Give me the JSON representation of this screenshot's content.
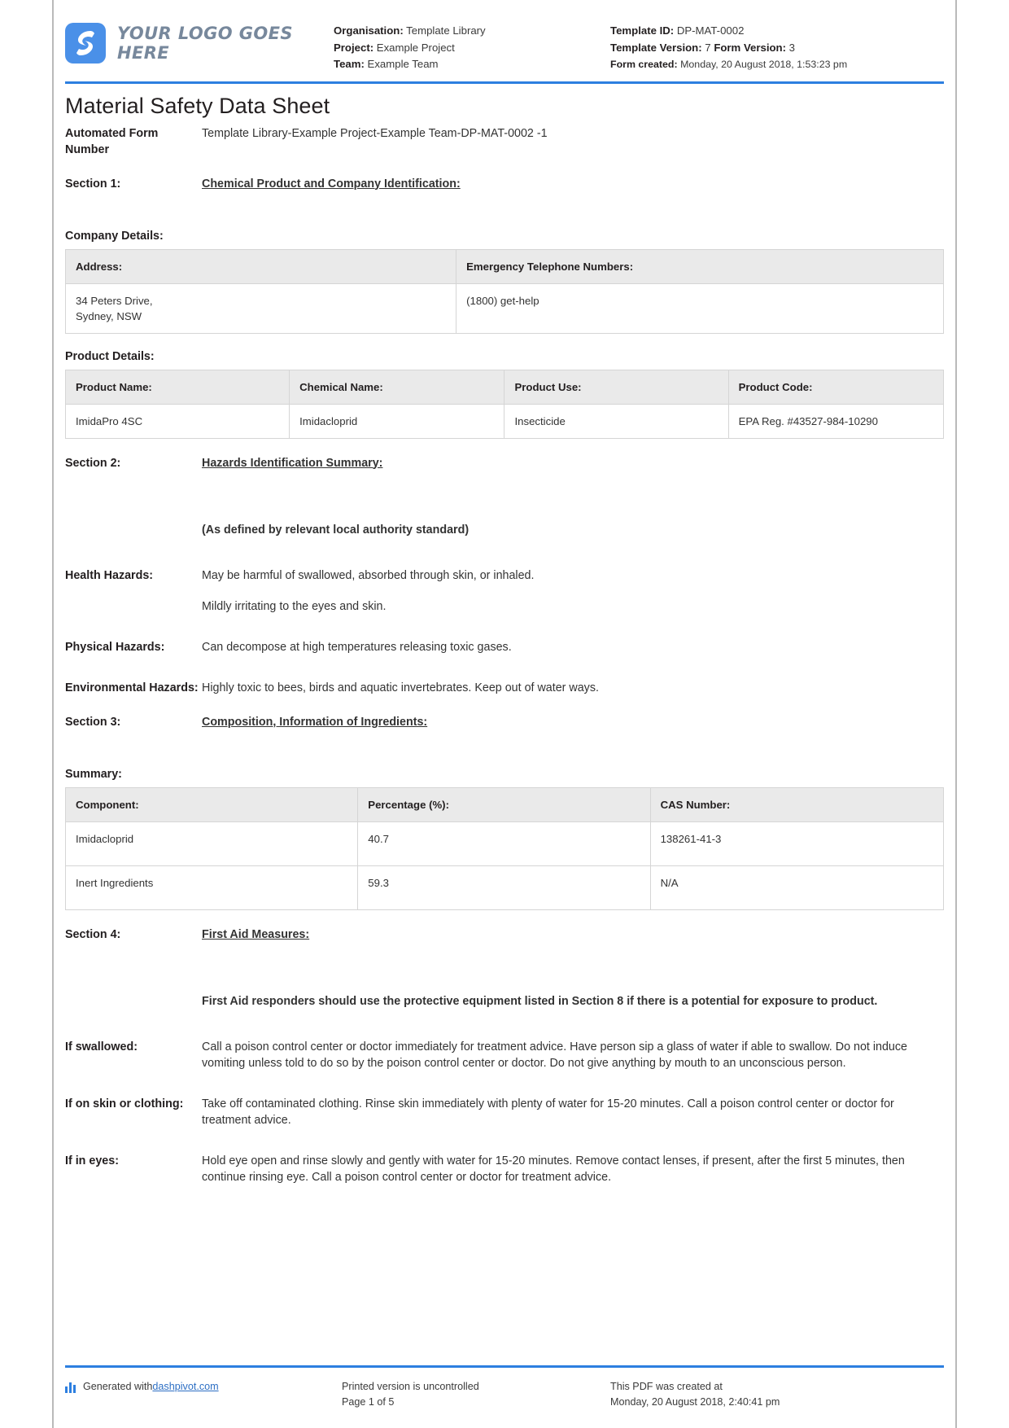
{
  "brand": {
    "logo_text": "YOUR LOGO GOES HERE",
    "accent_color": "#2d7fe0",
    "logo_bg_color": "#4a90e8",
    "logo_text_color": "#77889c"
  },
  "header": {
    "organisation_label": "Organisation:",
    "organisation_value": "Template Library",
    "project_label": "Project:",
    "project_value": "Example Project",
    "team_label": "Team:",
    "team_value": "Example Team",
    "template_id_label": "Template ID:",
    "template_id_value": "DP-MAT-0002",
    "template_version_label": "Template Version:",
    "template_version_value": "7",
    "form_version_label": "Form Version:",
    "form_version_value": "3",
    "form_created_label": "Form created:",
    "form_created_value": "Monday, 20 August 2018, 1:53:23 pm"
  },
  "document": {
    "title": "Material Safety Data Sheet",
    "automated_form_number_label": "Automated Form Number",
    "automated_form_number_value": "Template Library-Example Project-Example Team-DP-MAT-0002   -1"
  },
  "sections": {
    "s1": {
      "label": "Section 1:",
      "title": "Chemical Product and Company Identification:"
    },
    "s2": {
      "label": "Section 2:",
      "title": "Hazards Identification Summary:",
      "note": "(As defined by relevant local authority standard)",
      "health_hazards_label": "Health Hazards:",
      "health_hazards_line1": "May be harmful of swallowed, absorbed through skin, or inhaled.",
      "health_hazards_line2": "Mildly irritating to the eyes and skin.",
      "physical_hazards_label": "Physical Hazards:",
      "physical_hazards_text": "Can decompose at high temperatures releasing toxic gases.",
      "environmental_hazards_label": "Environmental Hazards:",
      "environmental_hazards_text": "Highly toxic to bees, birds and aquatic invertebrates. Keep out of water ways."
    },
    "s3": {
      "label": "Section 3:",
      "title": "Composition, Information of Ingredients:",
      "summary_label": "Summary:"
    },
    "s4": {
      "label": "Section 4:",
      "title": "First Aid Measures:",
      "note": "First Aid responders should use the protective equipment listed in Section 8 if there is a potential for exposure to product.",
      "if_swallowed_label": "If swallowed:",
      "if_swallowed_text": "Call a poison control center or doctor immediately for treatment advice. Have person sip a glass of water if able to swallow. Do not induce vomiting unless told to do so by the poison control center or doctor. Do not give anything by mouth to an unconscious person.",
      "if_skin_label": "If on skin or clothing:",
      "if_skin_text": "Take off contaminated clothing. Rinse skin immediately with plenty of water for 15-20 minutes. Call a poison control center or doctor for treatment advice.",
      "if_eyes_label": "If in eyes:",
      "if_eyes_text": "Hold eye open and rinse slowly and gently with water for 15-20 minutes. Remove contact lenses, if present, after the first 5 minutes, then continue rinsing eye. Call a poison control center or doctor for treatment advice."
    }
  },
  "company_details": {
    "heading": "Company Details:",
    "columns": [
      "Address:",
      "Emergency Telephone Numbers:"
    ],
    "row": {
      "address_line1": "34 Peters Drive,",
      "address_line2": "Sydney, NSW",
      "emergency_phone": "(1800) get-help"
    }
  },
  "product_details": {
    "heading": "Product Details:",
    "columns": [
      "Product Name:",
      "Chemical Name:",
      "Product Use:",
      "Product Code:"
    ],
    "row": {
      "product_name": "ImidaPro 4SC",
      "chemical_name": "Imidacloprid",
      "product_use": "Insecticide",
      "product_code": "EPA Reg. #43527-984-10290"
    }
  },
  "composition": {
    "columns": [
      "Component:",
      "Percentage (%):",
      "CAS Number:"
    ],
    "rows": [
      {
        "component": "Imidacloprid",
        "percentage": "40.7",
        "cas": "138261-41-3"
      },
      {
        "component": "Inert Ingredients",
        "percentage": "59.3",
        "cas": "N/A"
      }
    ]
  },
  "footer": {
    "generated_prefix": "Generated with ",
    "generated_link": "dashpivot.com",
    "printed_notice": "Printed version is uncontrolled",
    "page_indicator": "Page 1 of 5",
    "created_notice": "This PDF was created at",
    "created_timestamp": "Monday, 20 August 2018, 2:40:41 pm"
  }
}
